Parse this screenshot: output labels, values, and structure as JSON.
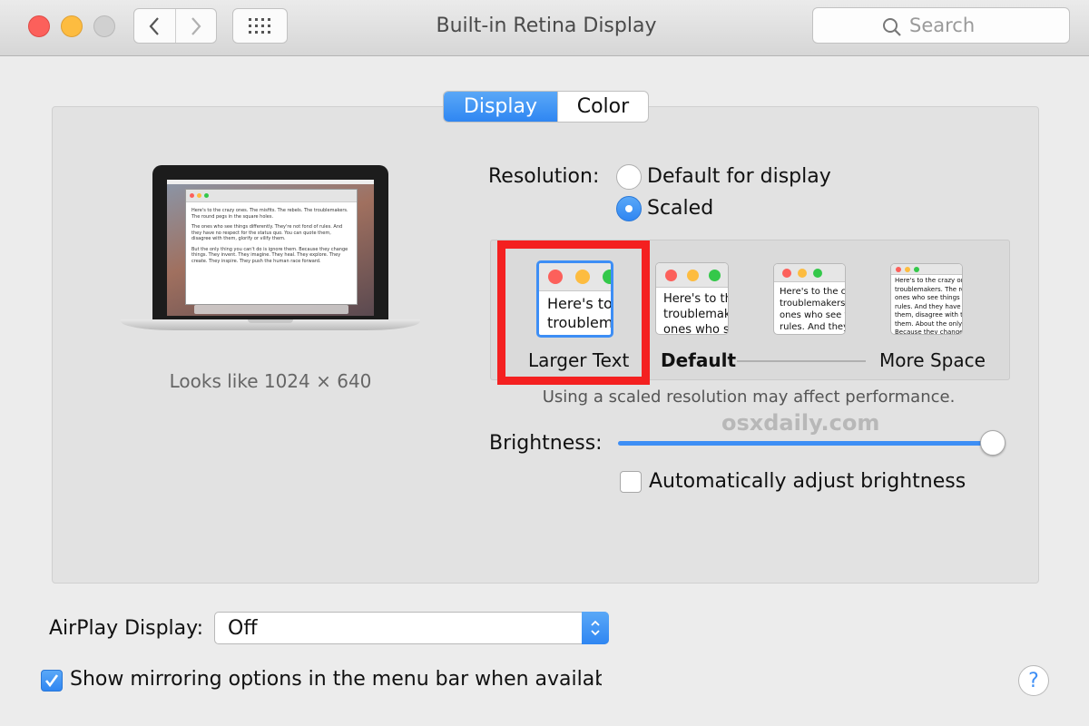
{
  "window": {
    "title": "Built-in Retina Display"
  },
  "toolbar": {
    "search_placeholder": "Search"
  },
  "tabs": [
    {
      "label": "Display",
      "active": true
    },
    {
      "label": "Color",
      "active": false
    }
  ],
  "preview": {
    "looks_like": "Looks like 1024 × 640",
    "doc_paragraphs": [
      "Here's to the crazy ones. The misfits. The rebels. The troublemakers. The round pegs in the square holes.",
      "The ones who see things differently. They're not fond of rules. And they have no respect for the status quo. You can quote them, disagree with them, glorify or vilify them.",
      "But the only thing you can't do is ignore them. Because they change things. They invent. They imagine. They heal. They explore. They create. They inspire. They push the human race forward."
    ]
  },
  "resolution": {
    "label": "Resolution:",
    "options": [
      {
        "label": "Default for display",
        "selected": false
      },
      {
        "label": "Scaled",
        "selected": true
      }
    ],
    "scaled_options": [
      {
        "label": "Larger Text",
        "preview": "Here's to\ntroublem",
        "selected": true
      },
      {
        "label": "Default",
        "preview": "Here's to th\ntroublemak\nones who s",
        "selected": false
      },
      {
        "label": "",
        "preview": "Here's to the cr\ntroublemakers.\nones who see t\nrules. And they",
        "selected": false
      },
      {
        "label": "More Space",
        "preview": "Here's to the crazy one\ntroublemakers. The rou\nones who see things di\nrules. And they have n\nthem, disagree with the\nthem. About the only th\nBecause they change t",
        "selected": false
      }
    ],
    "note": "Using a scaled resolution may affect performance."
  },
  "watermark": "osxdaily.com",
  "brightness": {
    "label": "Brightness:",
    "value": 0.96,
    "auto_label": "Automatically adjust brightness",
    "auto_checked": false
  },
  "airplay": {
    "label": "AirPlay Display:",
    "value": "Off"
  },
  "mirroring": {
    "label": "Show mirroring options in the menu bar when available",
    "checked": true
  },
  "help": {
    "label": "?"
  },
  "colors": {
    "accent": "#3d8ef5",
    "highlight_box": "#f42020",
    "close": "#fc605b",
    "minimize": "#fdbc40",
    "zoom": "#34c84a"
  }
}
